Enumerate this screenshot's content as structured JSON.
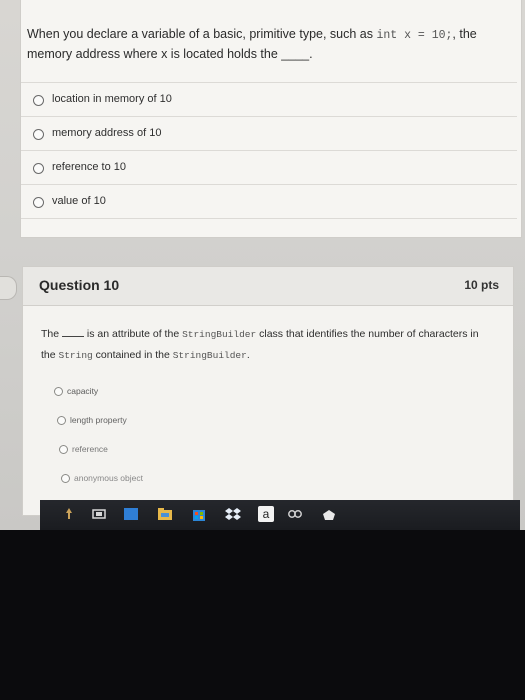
{
  "question9": {
    "text_before_code": "When you declare a variable of a basic, primitive type, such as ",
    "code": "int x = 10;",
    "text_after_code": ", the memory address where x is located holds the ",
    "blank": "____",
    "text_end": ".",
    "options": [
      {
        "label": "location in memory of 10"
      },
      {
        "label": "memory address of 10"
      },
      {
        "label": "reference to 10"
      },
      {
        "label": "value of 10"
      }
    ]
  },
  "question10": {
    "title": "Question 10",
    "points": "10 pts",
    "text_1": "The ",
    "text_2": " is an attribute of the ",
    "code_1": "StringBuilder",
    "text_3": " class that identifies the number of characters in the ",
    "code_2": "String",
    "text_4": " contained in the ",
    "code_3": "StringBuilder",
    "text_5": ".",
    "options": [
      {
        "label": "capacity"
      },
      {
        "label": "length property"
      },
      {
        "label": "reference"
      },
      {
        "label": "anonymous object"
      }
    ]
  },
  "taskbar": {
    "icons": [
      {
        "name": "pin-icon",
        "color": "#caa25a"
      },
      {
        "name": "task-view-icon",
        "color": "#d8d8d8"
      },
      {
        "name": "edge-icon",
        "color": "#2f7fd6"
      },
      {
        "name": "file-explorer-icon",
        "color": "#e7b84a"
      },
      {
        "name": "store-icon",
        "color": "#2c86d6"
      },
      {
        "name": "dropbox-icon",
        "color": "#3d8fe8"
      },
      {
        "name": "amazon-icon",
        "color": "#f2f2f2"
      },
      {
        "name": "settings-icon",
        "color": "#d0d0d0"
      },
      {
        "name": "bag-icon",
        "color": "#9aa0a8"
      }
    ],
    "amazon_letter": "a"
  }
}
